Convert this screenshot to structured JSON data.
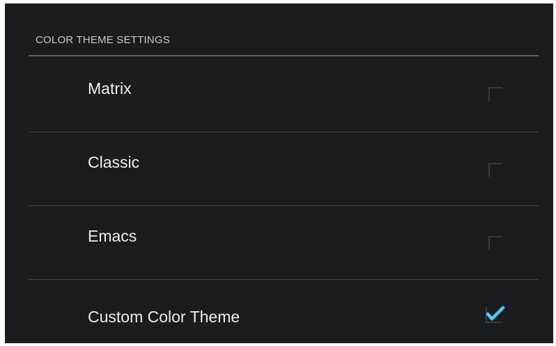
{
  "section": {
    "title": "COLOR THEME SETTINGS"
  },
  "themes": [
    {
      "label": "Matrix",
      "checked": false
    },
    {
      "label": "Classic",
      "checked": false
    },
    {
      "label": "Emacs",
      "checked": false
    },
    {
      "label": "Custom Color Theme",
      "checked": true
    }
  ],
  "colors": {
    "background": "#1b1c1f",
    "accent": "#33b5e5"
  }
}
